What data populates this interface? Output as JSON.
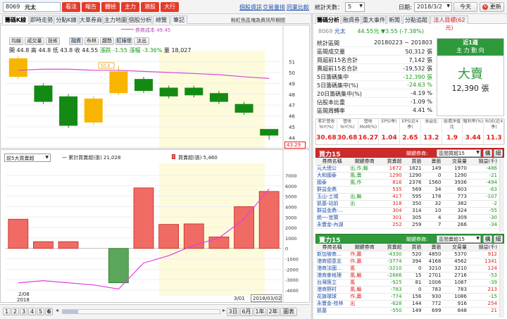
{
  "top": {
    "stock_code": "8069",
    "stock_name": "元太",
    "func_buttons": [
      "看法",
      "報告",
      "體檢",
      "主力",
      "港股",
      "大行"
    ],
    "links": [
      "個股資訊",
      "交易量排",
      "同業比較"
    ],
    "stat_days_label": "統計天數：",
    "stat_days_value": "5",
    "date_label": "日期:",
    "date_value": "2018/3/2",
    "today_button": "今天",
    "refresh_button": "更新"
  },
  "left_tabs": [
    "籌碼K線",
    "即時走勢",
    "分點K線",
    "大單券商",
    "主力地圖",
    "個股分析",
    "總覽",
    "筆記"
  ],
  "notice": "粉紅色區塊為資訊所期間",
  "legend": {
    "cost_label": "券商成本 49.45"
  },
  "chart_tabs": [
    "均線",
    "成交量",
    "技術",
    "融資",
    "布林",
    "趨勢",
    "紅綠燈",
    "汰出"
  ],
  "ohlc": {
    "open_label": "開",
    "open": "44.8",
    "high_label": "高",
    "high": "44.8",
    "low_label": "低",
    "low": "43.8",
    "close_label": "收",
    "close": "44.55",
    "change_label": "漲跌",
    "change": "-1.55",
    "pct_label": "漲幅",
    "pct": "-3.36%",
    "vol_label": "量",
    "vol": "18,027"
  },
  "lower_panel": {
    "select_value": "前5大買賣超",
    "legend_cum": "一 累計買賣超(張) 21,028",
    "legend_bar": "買賣超(張) 5,460"
  },
  "x_axis": {
    "start_date": "2/08",
    "start_year": "2018",
    "mid_date": "3/01",
    "end_date": "2018/03/02"
  },
  "bottom": {
    "pages": [
      "1",
      "2",
      "3",
      "4",
      "5",
      "6"
    ],
    "ranges": [
      "3日",
      "6月",
      "1年",
      "2年",
      "圖表"
    ]
  },
  "right": {
    "tabs": [
      "籌碼分析",
      "融資券",
      "重大事件",
      "新聞",
      "分點追蹤",
      "法人目標(62元)"
    ],
    "price_line": {
      "code": "8069",
      "name": "元太",
      "price": "44.55元",
      "change": "▼3.55 (-7.38%)"
    },
    "stats": [
      {
        "label": "統計區間",
        "value": "20180223 ~ 201803"
      },
      {
        "label": "區間成交量",
        "value": "50,312 張"
      },
      {
        "label": "買超前15名合計",
        "value": "7,142 張"
      },
      {
        "label": "賣超前15名合計",
        "value": "-19,532 張"
      },
      {
        "label": "5日籌碼集中",
        "value": "-12,390 張"
      },
      {
        "label": "5日籌碼集中(%)",
        "value": "-24.63 %"
      },
      {
        "label": "20日籌碼集中(%)",
        "value": "-4.19 %"
      },
      {
        "label": "佔股本比重",
        "value": "-1.09 %"
      },
      {
        "label": "區間周轉率",
        "value": "4.41 %"
      }
    ],
    "trend_box": {
      "title": "近1週",
      "subtitle": "主 力 動 向",
      "big": "大賣",
      "value": "12,390 張"
    },
    "metrics_headers": [
      "累計營收YoY(%)",
      "營收YoY(%)",
      "營收MoM(%)",
      "EPS(季)",
      "EPS(近4季)",
      "本益比",
      "股價淨值比",
      "殖利率(%)",
      "ROE(近4季)"
    ],
    "metrics_values": [
      "30.68",
      "30.68",
      "16.27",
      "1.04",
      "2.65",
      "13.2",
      "1.9",
      "3.44",
      "11.3"
    ],
    "buy": {
      "title": "買力15",
      "related_label": "關鍵券商:",
      "select_value": "區間買超15",
      "btn1": "構",
      "btn2": "細",
      "headers": [
        "券商名稱",
        "關鍵券商",
        "買賣超",
        "買張",
        "賣張",
        "交易量",
        "損益(千)"
      ],
      "rows": [
        [
          "元大總公",
          "出,作,輸",
          "1672",
          "1821",
          "149",
          "1970",
          "-486"
        ],
        [
          "大和國泰",
          "風,賣",
          "1290",
          "1290",
          "0",
          "1290",
          "-21"
        ],
        [
          "國泰",
          "風,作",
          "816",
          "2376",
          "1560",
          "3936",
          "-494"
        ],
        [
          "群益金鼎",
          "",
          "535",
          "569",
          "34",
          "603",
          "-63"
        ],
        [
          "玉山-土城",
          "出,輸",
          "417",
          "595",
          "178",
          "773",
          "-107"
        ],
        [
          "凱基-站前",
          "出",
          "318",
          "350",
          "32",
          "382",
          "-2"
        ],
        [
          "群益金鼎-...",
          "",
          "304",
          "314",
          "10",
          "324",
          "-55"
        ],
        [
          "統一-宜蘭",
          "",
          "301",
          "305",
          "4",
          "309",
          "-30"
        ],
        [
          "永豐金-內湖",
          "",
          "252",
          "259",
          "7",
          "266",
          "-34"
        ]
      ]
    },
    "sell": {
      "title": "賣力15",
      "related_label": "關鍵券商:",
      "select_value": "區間賣超15",
      "btn1": "構",
      "btn2": "細",
      "headers": [
        "券商名稱",
        "關鍵券商",
        "買賣超",
        "買張",
        "賣張",
        "交易量",
        "損益(千)"
      ],
      "rows": [
        [
          "新加坡商...",
          "作,贏",
          "-4330",
          "520",
          "4850",
          "5370",
          "912"
        ],
        [
          "港商德意志",
          "作,贏",
          "-3774",
          "394",
          "4168",
          "4562",
          "1341"
        ],
        [
          "港商法國...",
          "風",
          "-3210",
          "0",
          "3210",
          "3210",
          "124"
        ],
        [
          "港商麥格理",
          "風,輸",
          "-2686",
          "15",
          "2701",
          "2716",
          "-53"
        ],
        [
          "台灣匯立",
          "風",
          "-925",
          "81",
          "1006",
          "1087",
          "-39"
        ],
        [
          "港商野村",
          "風,輸",
          "-783",
          "0",
          "783",
          "783",
          "213"
        ],
        [
          "花旗環球",
          "作,贏",
          "-774",
          "156",
          "930",
          "1086",
          "-15"
        ],
        [
          "永豐金-桂林",
          "出",
          "-628",
          "144",
          "772",
          "916",
          "254"
        ],
        [
          "凱基",
          "",
          "-550",
          "149",
          "699",
          "848",
          "21"
        ]
      ]
    }
  },
  "chart_data": [
    {
      "type": "candlestick",
      "ylim": [
        43,
        52
      ],
      "y_ticks": [
        44,
        45,
        46,
        47,
        48,
        49,
        50,
        51
      ],
      "cost_line": 49.45,
      "current_price_label": "43.29",
      "high_marker": "50.6",
      "candles": [
        {
          "open": 49.6,
          "close": 51.3,
          "high": 51.5,
          "low": 49.4
        },
        {
          "open": 48.8,
          "close": 47.3,
          "high": 49.0,
          "low": 47.1
        },
        {
          "open": 47.8,
          "close": 45.1,
          "high": 48.0,
          "low": 44.9
        },
        {
          "open": 45.4,
          "close": 47.6,
          "high": 47.8,
          "low": 45.2
        },
        {
          "open": 48.1,
          "close": 50.1,
          "high": 50.6,
          "low": 47.9
        },
        {
          "open": 49.4,
          "close": 48.3,
          "high": 49.6,
          "low": 48.1
        },
        {
          "open": 48.6,
          "close": 47.8,
          "high": 48.8,
          "low": 47.6
        },
        {
          "open": 48.6,
          "close": 47.9,
          "high": 48.8,
          "low": 47.7
        },
        {
          "open": 48.1,
          "close": 47.3,
          "high": 48.3,
          "low": 47.1
        },
        {
          "open": 47.1,
          "close": 46.3,
          "high": 47.3,
          "low": 46.1
        },
        {
          "open": 44.8,
          "close": 44.2,
          "high": 44.8,
          "low": 43.8
        }
      ],
      "cost_series": [
        50.2,
        50.3,
        50.3,
        50.2,
        50.2,
        50.1,
        50.0,
        49.9,
        49.8,
        49.6,
        49.45
      ]
    },
    {
      "type": "bar",
      "ylim": [
        -4000,
        7000
      ],
      "y_ticks": [
        7000,
        6000,
        5000,
        4000,
        3000,
        2000,
        1000,
        0,
        -1000,
        -2000,
        -3000,
        -4000
      ],
      "values": [
        2800,
        650,
        650,
        null,
        -3300,
        5800,
        2300,
        2350,
        1100,
        4000,
        5460
      ],
      "cumulative": [
        -3300,
        -3100,
        -3300,
        -3500,
        -3900,
        -1400,
        -700,
        300,
        1000,
        2800,
        5700
      ]
    }
  ]
}
